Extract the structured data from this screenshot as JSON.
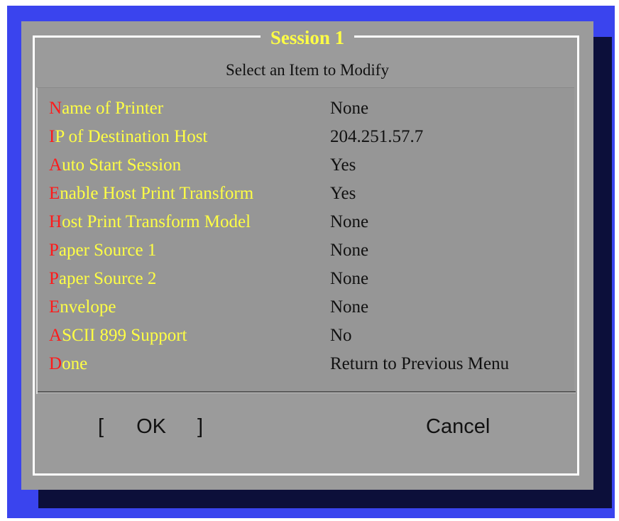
{
  "dialog": {
    "title": "Session 1",
    "subtitle": "Select an Item to Modify"
  },
  "menu": {
    "items": [
      {
        "hotkey": "N",
        "rest": "ame of Printer",
        "value": "None"
      },
      {
        "hotkey": "I",
        "rest": "P of Destination Host",
        "value": "204.251.57.7"
      },
      {
        "hotkey": "A",
        "rest": "uto Start Session",
        "value": "Yes"
      },
      {
        "hotkey": "E",
        "rest": "nable Host Print Transform",
        "value": "Yes"
      },
      {
        "hotkey": "H",
        "rest": "ost Print Transform Model",
        "value": "None"
      },
      {
        "hotkey": "P",
        "rest": "aper Source 1",
        "value": "None"
      },
      {
        "hotkey": "P",
        "rest": "aper Source 2",
        "value": "None"
      },
      {
        "hotkey": "E",
        "rest": "nvelope",
        "value": "None"
      },
      {
        "hotkey": "A",
        "rest": "SCII 899 Support",
        "value": "No"
      },
      {
        "hotkey": "D",
        "rest": "one",
        "value": "Return to Previous Menu"
      }
    ]
  },
  "buttons": {
    "ok_open": "[",
    "ok_label": "OK",
    "ok_close": "]",
    "cancel_label": "Cancel"
  },
  "colors": {
    "background": "#3a44ee",
    "dialog": "#9b9b9b",
    "title": "#ffff44",
    "hotkey": "#ff1a1a",
    "label": "#ffff44"
  }
}
